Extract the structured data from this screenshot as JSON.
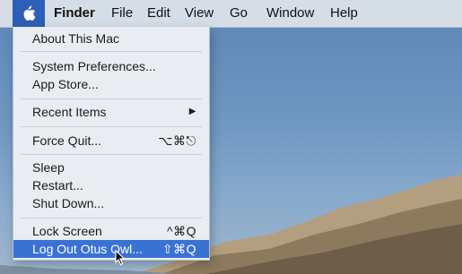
{
  "menubar": {
    "apple_icon": "apple-logo-icon",
    "items": [
      "Finder",
      "File",
      "Edit",
      "View",
      "Go",
      "Window",
      "Help"
    ]
  },
  "apple_menu": {
    "about": "About This Mac",
    "system_prefs": "System Preferences...",
    "app_store": "App Store...",
    "recent_items": "Recent Items",
    "recent_items_arrow": "▶",
    "force_quit": "Force Quit...",
    "force_quit_shortcut": "⌥⌘⎋",
    "sleep": "Sleep",
    "restart": "Restart...",
    "shut_down": "Shut Down...",
    "lock_screen": "Lock Screen",
    "lock_screen_shortcut": "^⌘Q",
    "log_out": "Log Out Otus Owl...",
    "log_out_shortcut": "⇧⌘Q"
  },
  "colors": {
    "menubar_bg": "#d5dde7",
    "highlight": "#3a72d4",
    "apple_slot": "#2d5fb8"
  }
}
